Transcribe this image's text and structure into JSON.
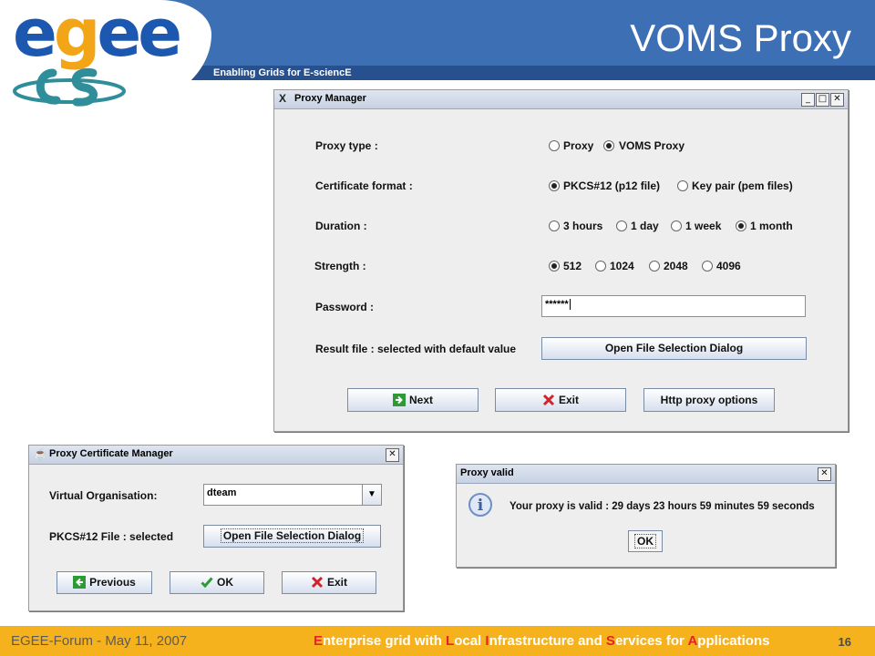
{
  "header": {
    "logo_text": "egee",
    "tagline": "Enabling Grids for E-sciencE",
    "title": "VOMS Proxy"
  },
  "proxy_manager": {
    "title": "Proxy Manager",
    "rows": {
      "proxy_type": {
        "label": "Proxy type :",
        "options": [
          "Proxy",
          "VOMS Proxy"
        ],
        "selected": "VOMS Proxy"
      },
      "cert_format": {
        "label": "Certificate format :",
        "options": [
          "PKCS#12 (p12 file)",
          "Key pair (pem files)"
        ],
        "selected": "PKCS#12 (p12 file)"
      },
      "duration": {
        "label": "Duration :",
        "options": [
          "3 hours",
          "1 day",
          "1 week",
          "1 month"
        ],
        "selected": "1 month"
      },
      "strength": {
        "label": "Strength :",
        "options": [
          "512",
          "1024",
          "2048",
          "4096"
        ],
        "selected": "512"
      }
    },
    "password": {
      "label": "Password :",
      "value": "******"
    },
    "result_file": {
      "label": "Result file : selected with default value",
      "button": "Open File Selection Dialog"
    },
    "buttons": {
      "next": "Next",
      "exit": "Exit",
      "http": "Http proxy options"
    }
  },
  "cert_manager": {
    "title": "Proxy Certificate Manager",
    "vo": {
      "label": "Virtual Organisation:",
      "value": "dteam"
    },
    "pkcs": {
      "label": "PKCS#12 File : selected",
      "button": "Open File Selection Dialog"
    },
    "buttons": {
      "previous": "Previous",
      "ok": "OK",
      "exit": "Exit"
    }
  },
  "proxy_valid": {
    "title": "Proxy valid",
    "message": "Your proxy is valid : 29 days 23 hours 59 minutes 59 seconds",
    "ok": "OK"
  },
  "footer": {
    "left": "EGEE-Forum - May 11, 2007",
    "center_parts": [
      "E",
      "nterprise grid with ",
      "L",
      "ocal ",
      "I",
      "nfrastructure and ",
      "S",
      "ervices for ",
      "A",
      "pplications"
    ],
    "page": "16"
  },
  "colors": {
    "header_blue": "#3d6fb5",
    "footer_orange": "#f6b21c",
    "highlight_red": "#e8212a"
  }
}
